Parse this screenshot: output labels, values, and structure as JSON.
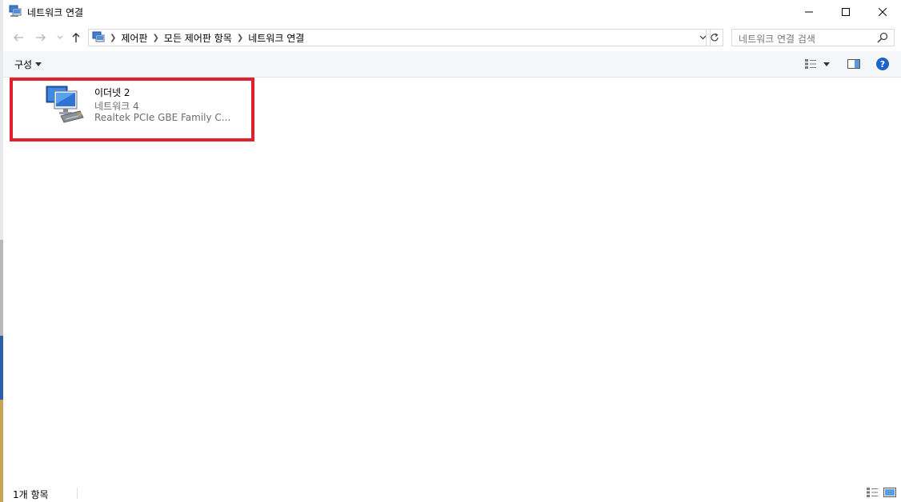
{
  "window": {
    "title": "네트워크 연결"
  },
  "nav": {
    "breadcrumbs": [
      "제어판",
      "모든 제어판 항목",
      "네트워크 연결"
    ],
    "search_placeholder": "네트워크 연결 검색"
  },
  "toolbar": {
    "organize_label": "구성"
  },
  "items": [
    {
      "name": "이더넷 2",
      "network": "네트워크 4",
      "device": "Realtek PCIe GBE Family C..."
    }
  ],
  "status": {
    "count_text": "1개 항목"
  },
  "colors": {
    "highlight_border": "#e0202a",
    "help_blue": "#1e64c8"
  }
}
